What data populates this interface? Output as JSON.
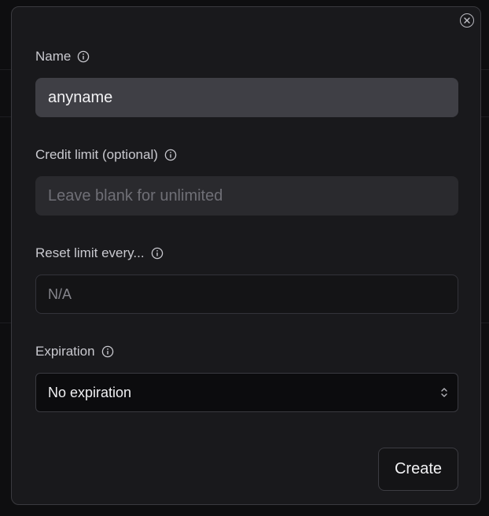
{
  "modal": {
    "fields": {
      "name": {
        "label": "Name",
        "value": "anyname"
      },
      "credit_limit": {
        "label": "Credit limit (optional)",
        "placeholder": "Leave blank for unlimited"
      },
      "reset_limit": {
        "label": "Reset limit every...",
        "placeholder": "N/A"
      },
      "expiration": {
        "label": "Expiration",
        "selected": "No expiration"
      }
    },
    "create_label": "Create"
  },
  "icons": {
    "close": "close-icon",
    "info": "info-icon",
    "select_arrows": "chevron-up-down-icon"
  },
  "colors": {
    "modal_bg": "#19191c",
    "filled_input_bg": "#3f3f45",
    "text_primary": "#f2f2f4",
    "text_label": "#c9c9cf"
  }
}
